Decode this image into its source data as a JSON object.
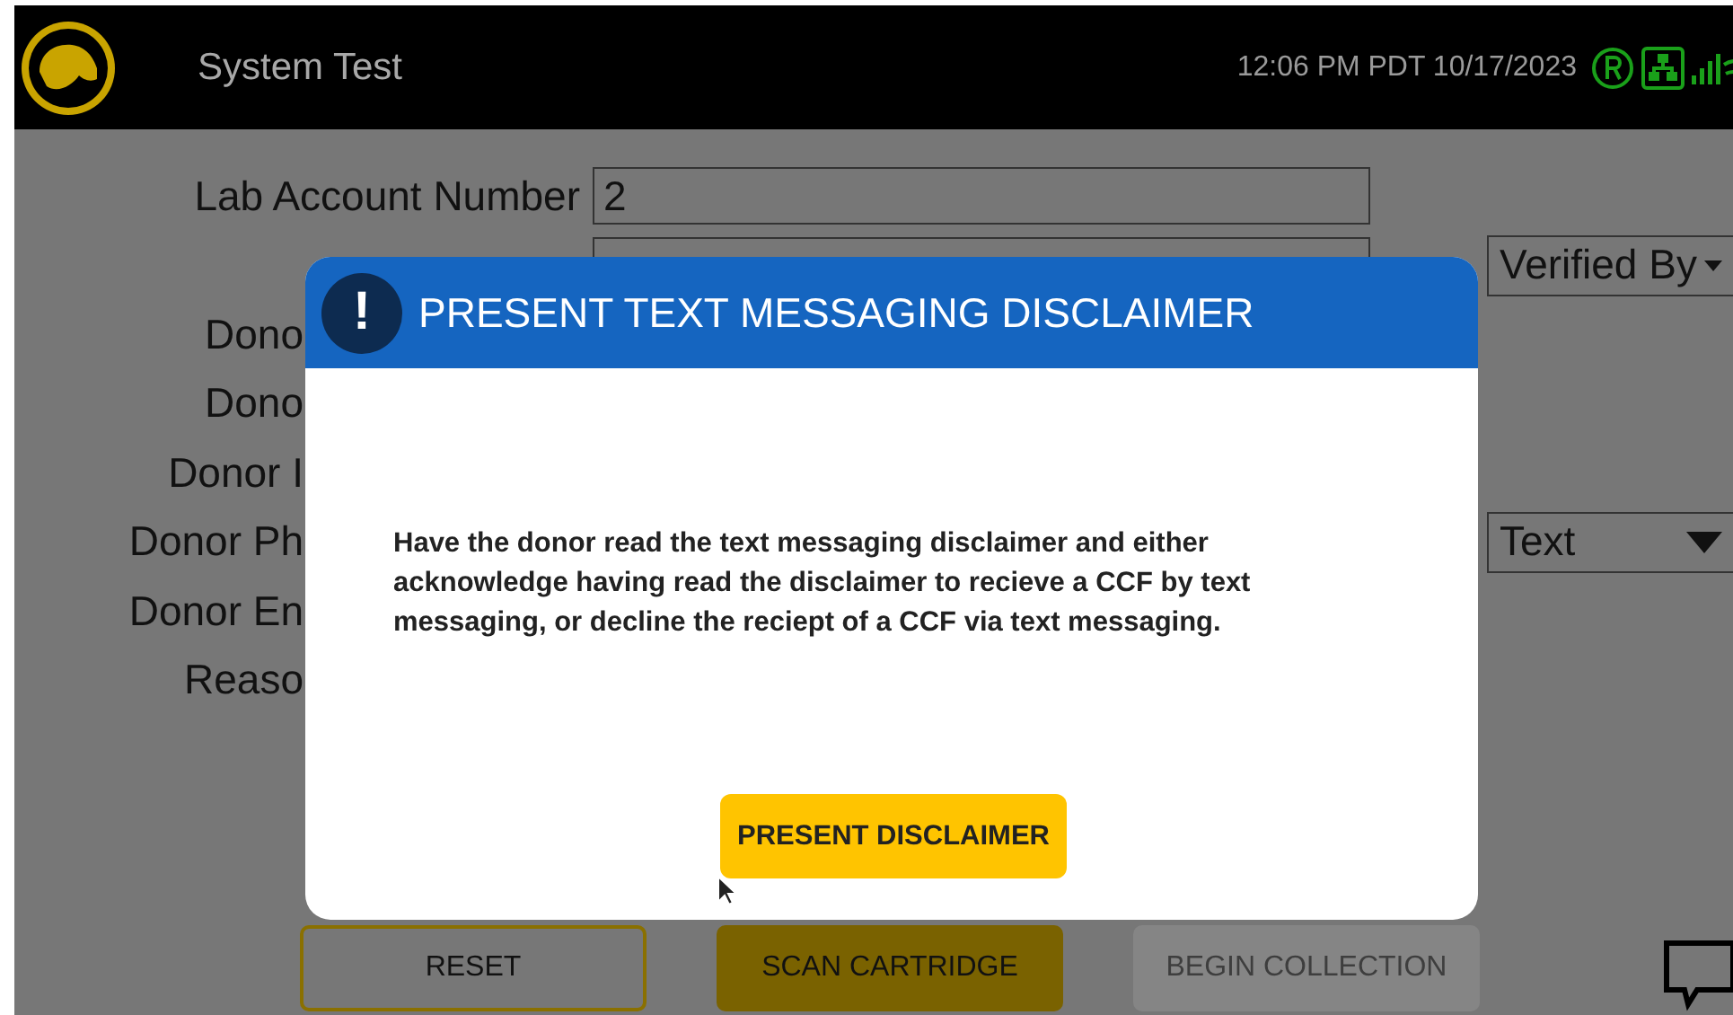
{
  "header": {
    "title": "System Test",
    "datetime": "12:06 PM PDT 10/17/2023"
  },
  "form": {
    "rows": [
      {
        "kind": "field",
        "label": "Lab Account Number",
        "value": "2"
      },
      {
        "kind": "dropdown_only",
        "dropdown": "Verified By"
      },
      {
        "kind": "partial",
        "label": "Dono"
      },
      {
        "kind": "partial",
        "label": "Dono"
      },
      {
        "kind": "partial",
        "label": "Donor I"
      },
      {
        "kind": "partial",
        "label": "Donor Ph",
        "dropdown": "Text"
      },
      {
        "kind": "partial",
        "label": "Donor En"
      },
      {
        "kind": "partial",
        "label": "Reaso"
      }
    ]
  },
  "dialog": {
    "title": "PRESENT TEXT MESSAGING DISCLAIMER",
    "icon_text": "!",
    "message": "Have the donor read the text messaging disclaimer and either acknowledge having read the disclaimer to recieve a CCF by text messaging, or decline the reciept of a CCF via text messaging.",
    "button": "PRESENT DISCLAIMER"
  },
  "footer_buttons": [
    {
      "kind": "outline",
      "label": "RESET",
      "disabled": false
    },
    {
      "kind": "filled",
      "label": "SCAN CARTRIDGE",
      "disabled": false
    },
    {
      "kind": "filled",
      "label": "BEGIN COLLECTION",
      "disabled": true
    }
  ]
}
